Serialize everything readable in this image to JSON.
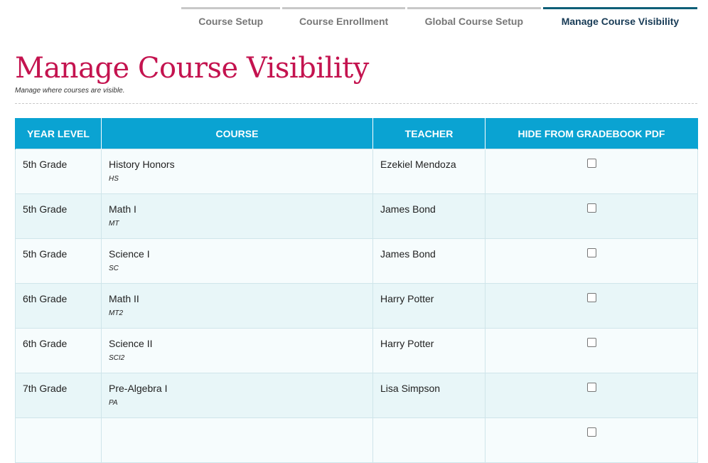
{
  "tabs": [
    {
      "label": "Course Setup",
      "active": false
    },
    {
      "label": "Course Enrollment",
      "active": false
    },
    {
      "label": "Global Course Setup",
      "active": false
    },
    {
      "label": "Manage Course Visibility",
      "active": true
    }
  ],
  "page": {
    "title": "Manage Course Visibility",
    "subtitle": "Manage where courses are visible."
  },
  "table": {
    "headers": [
      "YEAR LEVEL",
      "COURSE",
      "TEACHER",
      "HIDE FROM GRADEBOOK PDF"
    ],
    "rows": [
      {
        "year": "5th Grade",
        "course": "History Honors",
        "code": "HS",
        "teacher": "Ezekiel Mendoza",
        "hidden": false
      },
      {
        "year": "5th Grade",
        "course": "Math I",
        "code": "MT",
        "teacher": "James Bond",
        "hidden": false
      },
      {
        "year": "5th Grade",
        "course": "Science I",
        "code": "SC",
        "teacher": "James Bond",
        "hidden": false
      },
      {
        "year": "6th Grade",
        "course": "Math II",
        "code": "MT2",
        "teacher": "Harry Potter",
        "hidden": false
      },
      {
        "year": "6th Grade",
        "course": "Science II",
        "code": "SCI2",
        "teacher": "Harry Potter",
        "hidden": false
      },
      {
        "year": "7th Grade",
        "course": "Pre-Algebra I",
        "code": "PA",
        "teacher": "Lisa Simpson",
        "hidden": false
      },
      {
        "year": "",
        "course": "",
        "code": "",
        "teacher": "",
        "hidden": false
      }
    ]
  },
  "colors": {
    "accent": "#c4134f",
    "header_bg": "#0aa3d2",
    "active_tab": "#0e5f78"
  }
}
